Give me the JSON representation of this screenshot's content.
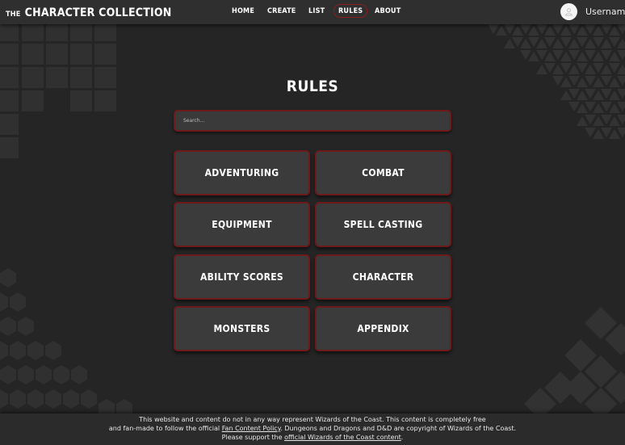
{
  "header": {
    "logo_prefix": "THE",
    "logo_main": "CHARACTER COLLECTION",
    "nav": [
      {
        "label": "HOME"
      },
      {
        "label": "CREATE"
      },
      {
        "label": "LIST"
      },
      {
        "label": "RULES",
        "active": true
      },
      {
        "label": "ABOUT"
      }
    ],
    "username": "Username"
  },
  "main": {
    "title": "RULES",
    "search_placeholder": "Search...",
    "categories": [
      {
        "label": "ADVENTURING"
      },
      {
        "label": "COMBAT"
      },
      {
        "label": "EQUIPMENT"
      },
      {
        "label": "SPELL CASTING"
      },
      {
        "label": "ABILITY SCORES"
      },
      {
        "label": "CHARACTER"
      },
      {
        "label": "MONSTERS"
      },
      {
        "label": "APPENDIX"
      }
    ]
  },
  "footer": {
    "line1": "This website and content do not in any way represent Wizards of the Coast. This content is completely free",
    "line2_pre": "and fan-made to follow the official ",
    "line2_link": "Fan Content Policy",
    "line2_post": ". Dungeons and Dragons and D&D are copyright of Wizards of the Coast.",
    "line3_pre": "Please support the ",
    "line3_link": "official Wizards of the Coast content",
    "line3_post": "."
  },
  "colors": {
    "background": "#252525",
    "header": "#2f2f2f",
    "card": "#3b3b3b",
    "accent_border": "#6e1a1a"
  }
}
